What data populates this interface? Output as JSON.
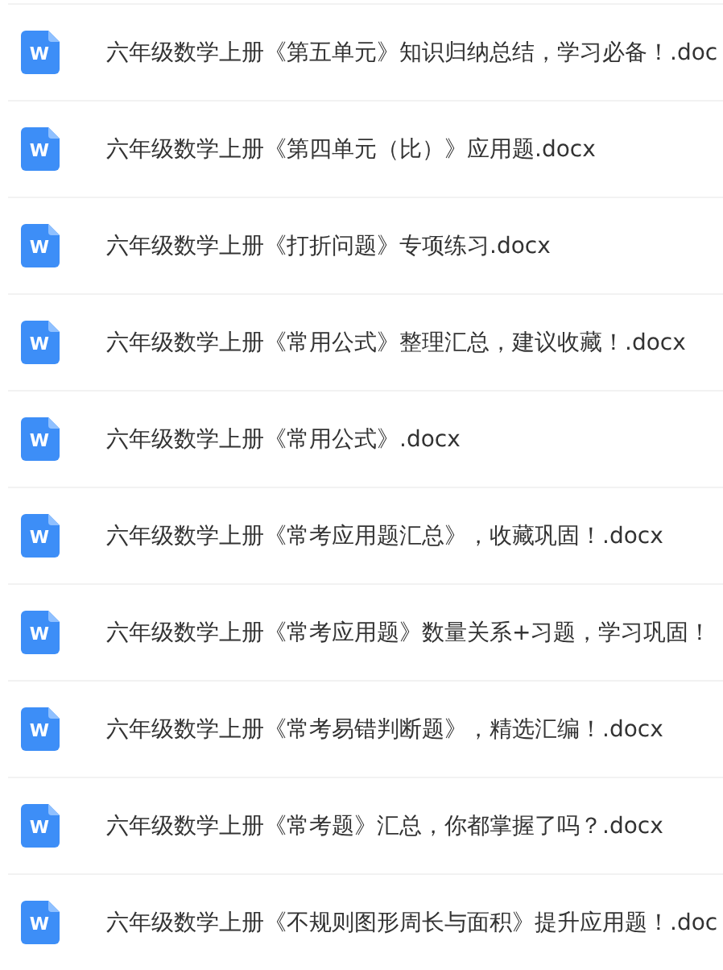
{
  "files": [
    {
      "icon_letter": "W",
      "name": "六年级数学上册《第五单元》知识归纳总结，学习必备！.doc"
    },
    {
      "icon_letter": "W",
      "name": "六年级数学上册《第四单元（比）》应用题.docx"
    },
    {
      "icon_letter": "W",
      "name": "六年级数学上册《打折问题》专项练习.docx"
    },
    {
      "icon_letter": "W",
      "name": "六年级数学上册《常用公式》整理汇总，建议收藏！.docx"
    },
    {
      "icon_letter": "W",
      "name": "六年级数学上册《常用公式》.docx"
    },
    {
      "icon_letter": "W",
      "name": "六年级数学上册《常考应用题汇总》，收藏巩固！.docx"
    },
    {
      "icon_letter": "W",
      "name": "六年级数学上册《常考应用题》数量关系+习题，学习巩固！"
    },
    {
      "icon_letter": "W",
      "name": "六年级数学上册《常考易错判断题》，精选汇编！.docx"
    },
    {
      "icon_letter": "W",
      "name": "六年级数学上册《常考题》汇总，你都掌握了吗？.docx"
    },
    {
      "icon_letter": "W",
      "name": "六年级数学上册《不规则图形周长与面积》提升应用题！.doc"
    }
  ]
}
